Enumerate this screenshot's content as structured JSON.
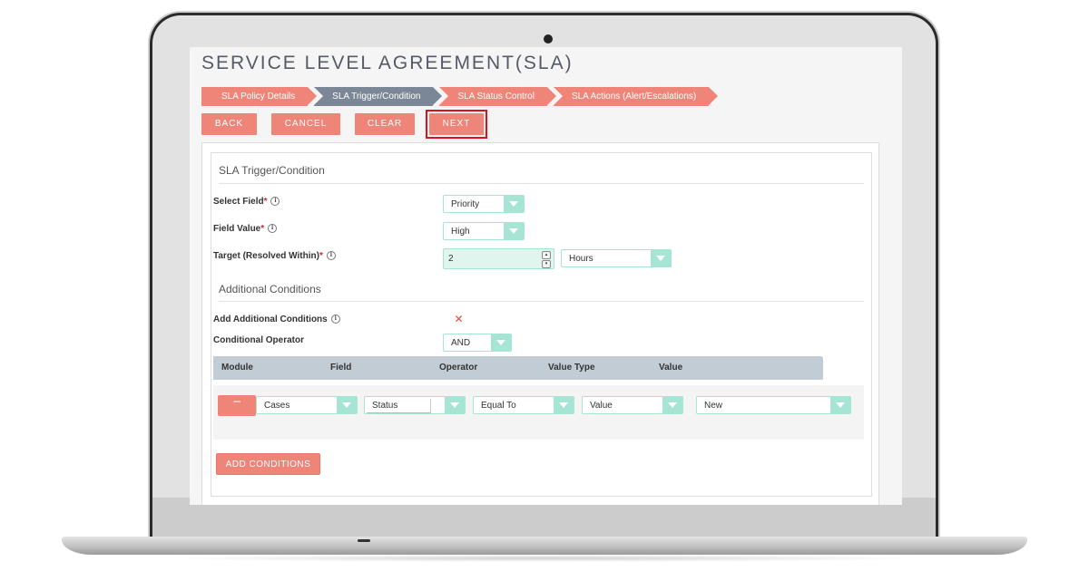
{
  "page": {
    "title": "SERVICE LEVEL AGREEMENT(SLA)"
  },
  "steps": [
    {
      "label": "SLA Policy Details",
      "active": false
    },
    {
      "label": "SLA Trigger/Condition",
      "active": true
    },
    {
      "label": "SLA Status Control",
      "active": false
    },
    {
      "label": "SLA Actions (Alert/Escalations)",
      "active": false
    }
  ],
  "toolbar": {
    "back": "BACK",
    "cancel": "CANCEL",
    "clear": "CLEAR",
    "next": "NEXT"
  },
  "trigger": {
    "section_title": "SLA Trigger/Condition",
    "select_field_label": "Select Field",
    "select_field_value": "Priority",
    "field_value_label": "Field Value",
    "field_value_value": "High",
    "target_label": "Target (Resolved Within)",
    "target_value": "2",
    "target_unit": "Hours",
    "required_mark": "*",
    "info_glyph": "i"
  },
  "additional": {
    "section_title": "Additional Conditions",
    "add_label": "Add Additional Conditions",
    "add_checked_glyph": "✕",
    "operator_label": "Conditional Operator",
    "operator_value": "AND"
  },
  "conditions_table": {
    "headers": [
      "Module",
      "Field",
      "Operator",
      "Value Type",
      "Value"
    ],
    "rows": [
      {
        "remove_glyph": "−",
        "module": "Cases",
        "field": "Status",
        "operator": "Equal To",
        "value_type": "Value",
        "value": "New"
      }
    ],
    "add_button": "ADD CONDITIONS"
  },
  "colors": {
    "accent": "#ef8579",
    "active_step": "#7b8796",
    "select_accent": "#a6e4d4",
    "highlight_border": "#d8131b"
  }
}
